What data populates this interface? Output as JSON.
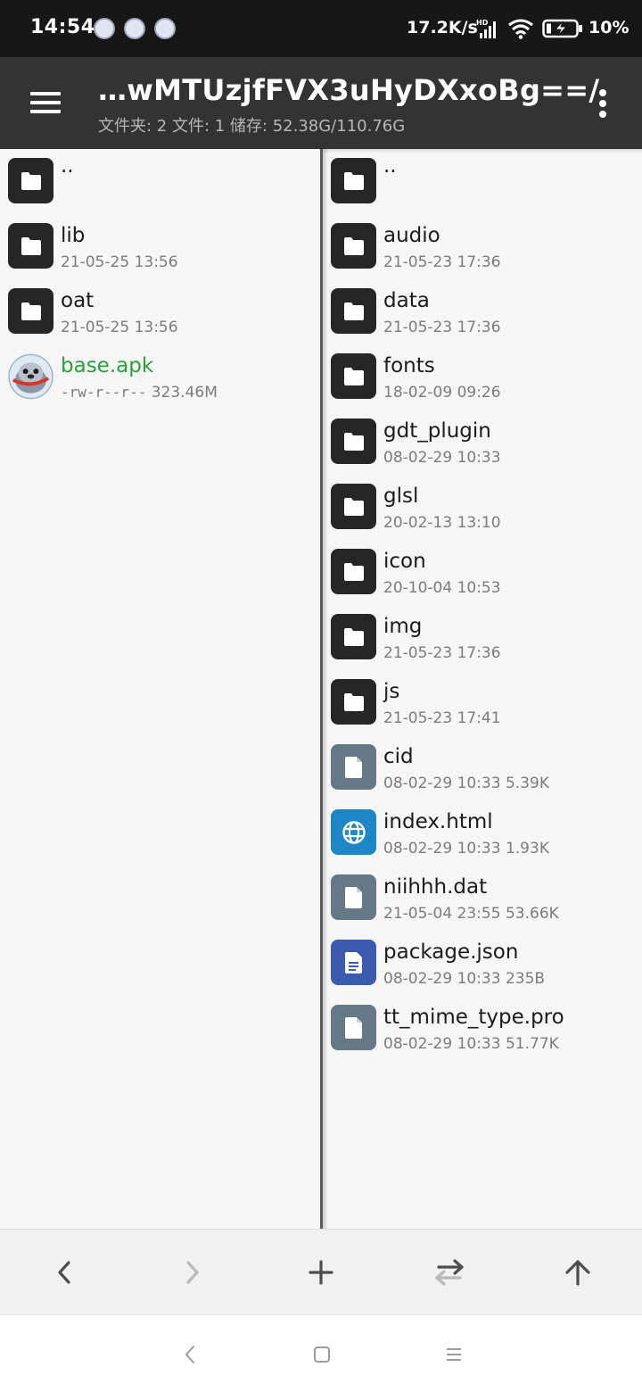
{
  "status_bar": {
    "time": "14:54",
    "net_speed": "17.2K/s",
    "battery": "10%",
    "icons": [
      "notification-app-icon",
      "notification-app-icon",
      "notification-app-icon",
      "hd-signal-icon",
      "wifi-icon",
      "battery-charging-icon"
    ]
  },
  "app_bar": {
    "path": "…wMTUzjfFVX3uHyDXxoBg==/",
    "stats": "文件夹: 2  文件: 1  储存: 52.38G/110.76G"
  },
  "left_pane": {
    "items": [
      {
        "name": "..",
        "meta": "",
        "type": "folder"
      },
      {
        "name": "lib",
        "meta": "21-05-25 13:56",
        "type": "folder"
      },
      {
        "name": "oat",
        "meta": "21-05-25 13:56",
        "type": "folder"
      },
      {
        "name": "base.apk",
        "perm": "-rw-r--r--",
        "size": "323.46M",
        "type": "apk"
      }
    ]
  },
  "right_pane": {
    "items": [
      {
        "name": "..",
        "meta": "",
        "type": "folder"
      },
      {
        "name": "audio",
        "meta": "21-05-23 17:36",
        "type": "folder"
      },
      {
        "name": "data",
        "meta": "21-05-23 17:36",
        "type": "folder"
      },
      {
        "name": "fonts",
        "meta": "18-02-09 09:26",
        "type": "folder"
      },
      {
        "name": "gdt_plugin",
        "meta": "08-02-29 10:33",
        "type": "folder"
      },
      {
        "name": "glsl",
        "meta": "20-02-13 13:10",
        "type": "folder"
      },
      {
        "name": "icon",
        "meta": "20-10-04 10:53",
        "type": "folder"
      },
      {
        "name": "img",
        "meta": "21-05-23 17:36",
        "type": "folder"
      },
      {
        "name": "js",
        "meta": "21-05-23 17:41",
        "type": "folder"
      },
      {
        "name": "cid",
        "meta": "08-02-29 10:33  5.39K",
        "type": "file"
      },
      {
        "name": "index.html",
        "meta": "08-02-29 10:33  1.93K",
        "type": "web"
      },
      {
        "name": "niihhh.dat",
        "meta": "21-05-04 23:55  53.66K",
        "type": "file"
      },
      {
        "name": "package.json",
        "meta": "08-02-29 10:33  235B",
        "type": "json"
      },
      {
        "name": "tt_mime_type.pro",
        "meta": "08-02-29 10:33  51.77K",
        "type": "file"
      }
    ]
  },
  "toolbar": {
    "buttons": [
      "back-arrow-icon",
      "forward-arrow-icon",
      "plus-icon",
      "swap-icon",
      "up-arrow-icon"
    ]
  },
  "nav_bar": {
    "buttons": [
      "nav-back-icon",
      "nav-home-icon",
      "nav-recents-icon"
    ]
  },
  "colors": {
    "status_bar_bg": "#171717",
    "app_bar_bg": "#333333",
    "folder_icon_bg": "#262626",
    "file_icon_bg": "#657886",
    "web_icon_bg": "#1d86c6",
    "json_icon_bg": "#3c5bb0",
    "apk_name": "#2aa03a"
  }
}
